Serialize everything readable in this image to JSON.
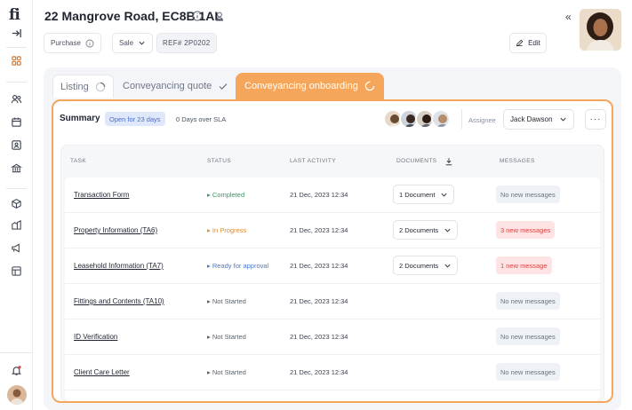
{
  "header": {
    "address": "22 Mangrove Road, EC8B 1AL",
    "purchase_label": "Purchase",
    "sale_label": "Sale",
    "ref": "REF# 2P0202",
    "edit_label": "Edit",
    "collapse_glyph": "«"
  },
  "tabs": [
    {
      "label": "Listing",
      "state": "in-progress"
    },
    {
      "label": "Conveyancing quote",
      "state": "done"
    },
    {
      "label": "Conveyancing onboarding",
      "state": "active"
    }
  ],
  "summary": {
    "title": "Summary",
    "open_badge": "Open for 23 days",
    "sla_text": "0 Days over SLA",
    "assignee_label": "Assignee",
    "assignee_value": "Jack Dawson",
    "more_glyph": "···"
  },
  "table": {
    "headers": [
      "TASK",
      "STATUS",
      "LAST ACTIVITY",
      "DOCUMENTS",
      "MESSAGES"
    ],
    "rows": [
      {
        "task": "Transaction Form",
        "status": "Completed",
        "activity": "21 Dec, 2023  12:34",
        "documents": "1 Document",
        "messages": "No new messages",
        "msg_type": "none"
      },
      {
        "task": "Property Information (TA6)",
        "status": "In Progress",
        "activity": "21 Dec, 2023  12:34",
        "documents": "2 Documents",
        "messages": "3 new messages",
        "msg_type": "new"
      },
      {
        "task": "Leasehold Information (TA7)",
        "status": "Ready for approval",
        "activity": "21 Dec, 2023  12:34",
        "documents": "2 Documents",
        "messages": "1 new message",
        "msg_type": "new"
      },
      {
        "task": "Fittings and Contents (TA10)",
        "status": "Not Started",
        "activity": "21 Dec, 2023  12:34",
        "documents": "",
        "messages": "No new messages",
        "msg_type": "none"
      },
      {
        "task": "ID Verification",
        "status": "Not Started",
        "activity": "21 Dec, 2023  12:34",
        "documents": "",
        "messages": "No new messages",
        "msg_type": "none"
      },
      {
        "task": "Client Care Letter",
        "status": "Not Started",
        "activity": "21 Dec, 2023  12:34",
        "documents": "",
        "messages": "No new messages",
        "msg_type": "none"
      }
    ]
  },
  "colors": {
    "accent": "#f5a65b",
    "completed": "#2f9e5a",
    "in_progress": "#e08a2c",
    "ready": "#4a78c9",
    "not_started": "#5a6170"
  }
}
